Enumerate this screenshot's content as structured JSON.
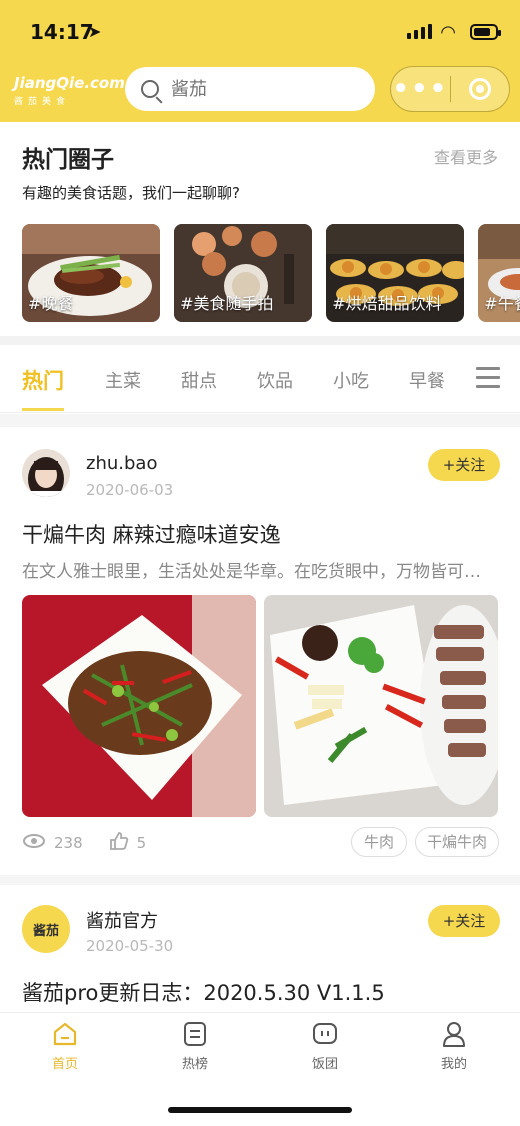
{
  "status": {
    "time": "14:17"
  },
  "header": {
    "logo_main": "JiangQie.com",
    "logo_sub": "酱茄美食",
    "search_placeholder": "酱茄"
  },
  "circles": {
    "title": "热门圈子",
    "more": "查看更多",
    "subtitle": "有趣的美食话题，我们一起聊聊?",
    "items": [
      {
        "label": "#晚餐"
      },
      {
        "label": "#美食随手拍"
      },
      {
        "label": "#烘焙甜品饮料"
      },
      {
        "label": "#午餐"
      }
    ]
  },
  "tabs": [
    "热门",
    "主菜",
    "甜点",
    "饮品",
    "小吃",
    "早餐"
  ],
  "posts": [
    {
      "user": "zhu.bao",
      "date": "2020-06-03",
      "follow": "+关注",
      "title": "干煸牛肉 麻辣过瘾味道安逸",
      "excerpt": "在文人雅士眼里，生活处处是华章。在吃货眼中，万物皆可…",
      "views": "238",
      "likes": "5",
      "tags": [
        "牛肉",
        "干煸牛肉"
      ]
    },
    {
      "user": "酱茄官方",
      "avatar_text": "酱茄",
      "date": "2020-05-30",
      "follow": "+关注",
      "title": "酱茄pro更新日志：2020.5.30 V1.1.5"
    }
  ],
  "tabbar": [
    {
      "label": "首页",
      "icon": "home-icon"
    },
    {
      "label": "热榜",
      "icon": "hot-list-icon"
    },
    {
      "label": "饭团",
      "icon": "group-icon"
    },
    {
      "label": "我的",
      "icon": "user-icon"
    }
  ],
  "colors": {
    "accent": "#f6d84f",
    "active_text": "#f0c020"
  }
}
